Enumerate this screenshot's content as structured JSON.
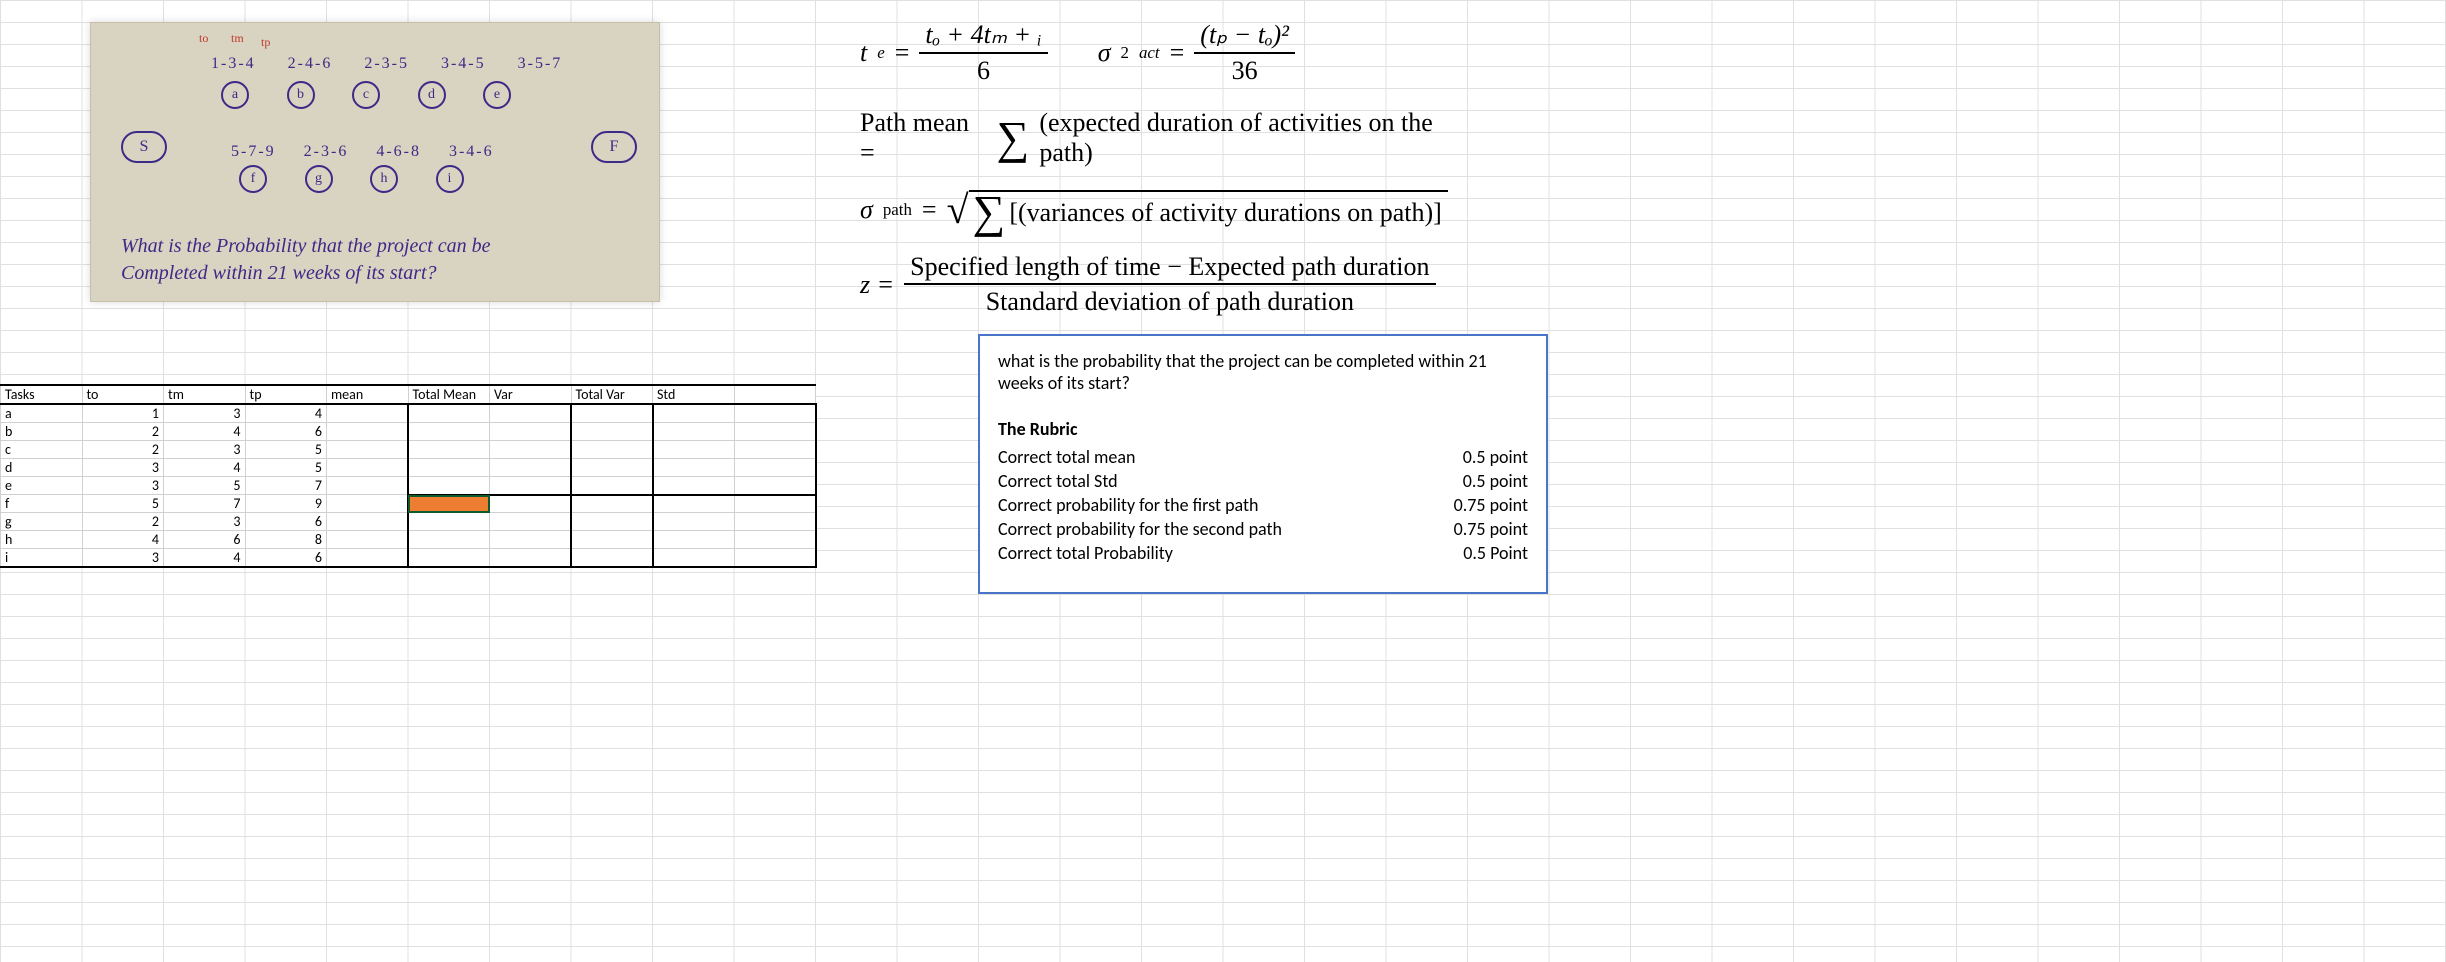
{
  "photo": {
    "labels_top": [
      "1-3-4",
      "2-4-6",
      "2-3-5",
      "3-4-5",
      "3-5-7"
    ],
    "nodes_top": [
      "a",
      "b",
      "c",
      "d",
      "e"
    ],
    "labels_bot": [
      "5-7-9",
      "2-3-6",
      "4-6-8",
      "3-4-6"
    ],
    "nodes_bot": [
      "f",
      "g",
      "h",
      "i"
    ],
    "source": "S",
    "sink": "F",
    "anno_to": "to",
    "anno_tm": "tm",
    "anno_tp": "tp",
    "question_l1": "What is the Probability that the project can be",
    "question_l2": "Completed within 21 weeks of its start?"
  },
  "formulas": {
    "te_lhs": "t",
    "te_sub": "e",
    "eq": " = ",
    "te_num": "tₒ + 4tₘ + ᵢ",
    "te_den": "6",
    "var_lhs": "σ",
    "var_sub": "act",
    "var_sup": "2",
    "var_num": "(tₚ − tₒ)²",
    "var_den": "36",
    "pathmean_lhs": "Path mean = ",
    "pathmean_body": "(expected duration of activities on the path)",
    "sigpath_lhs": "σ",
    "sigpath_sub": "path",
    "sigpath_body": "[(variances of activity durations on path)]",
    "z_lhs": "z = ",
    "z_num": "Specified length of time − Expected path duration",
    "z_den": "Standard deviation of path duration"
  },
  "rubric": {
    "question": "what is the probability that the project can be completed within 21 weeks of its start?",
    "heading": "The Rubric",
    "items": [
      {
        "label": "Correct total mean",
        "pts": "0.5 point"
      },
      {
        "label": "Correct total Std",
        "pts": "0.5 point"
      },
      {
        "label": "Correct probability for the first path",
        "pts": "0.75 point"
      },
      {
        "label": "Correct probability for the second path",
        "pts": "0.75 point"
      },
      {
        "label": "Correct total Probability",
        "pts": "0.5 Point"
      }
    ]
  },
  "table": {
    "headers": [
      "Tasks",
      "to",
      "tm",
      "tp",
      "mean",
      "Total Mean",
      "Var",
      "Total Var",
      "Std"
    ],
    "rows": [
      {
        "task": "a",
        "to": "1",
        "tm": "3",
        "tp": "4"
      },
      {
        "task": "b",
        "to": "2",
        "tm": "4",
        "tp": "6"
      },
      {
        "task": "c",
        "to": "2",
        "tm": "3",
        "tp": "5"
      },
      {
        "task": "d",
        "to": "3",
        "tm": "4",
        "tp": "5"
      },
      {
        "task": "e",
        "to": "3",
        "tm": "5",
        "tp": "7"
      },
      {
        "task": "f",
        "to": "5",
        "tm": "7",
        "tp": "9"
      },
      {
        "task": "g",
        "to": "2",
        "tm": "3",
        "tp": "6"
      },
      {
        "task": "h",
        "to": "4",
        "tm": "6",
        "tp": "8"
      },
      {
        "task": "i",
        "to": "3",
        "tm": "4",
        "tp": "6"
      }
    ]
  }
}
